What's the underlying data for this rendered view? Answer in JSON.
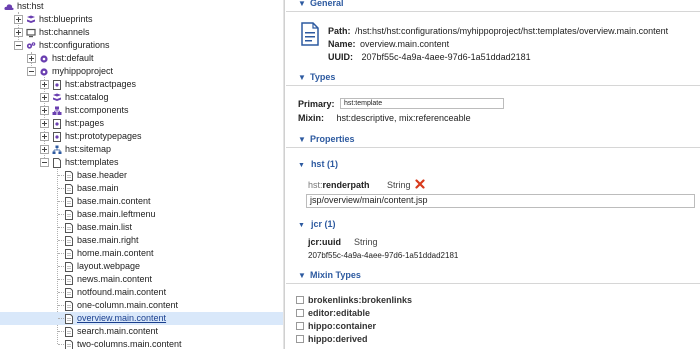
{
  "tree": {
    "root": "hst:hst",
    "blueprints": "hst:blueprints",
    "channels": "hst:channels",
    "configurations": "hst:configurations",
    "default": "hst:default",
    "project": "myhippoproject",
    "abstractpages": "hst:abstractpages",
    "catalog": "hst:catalog",
    "components": "hst:components",
    "pages": "hst:pages",
    "prototypepages": "hst:prototypepages",
    "sitemap": "hst:sitemap",
    "templates": "hst:templates",
    "template_items": [
      "base.header",
      "base.main",
      "base.main.content",
      "base.main.leftmenu",
      "base.main.list",
      "base.main.right",
      "home.main.content",
      "layout.webpage",
      "news.main.content",
      "notfound.main.content",
      "one-column.main.content",
      "overview.main.content",
      "search.main.content",
      "two-columns.main.content"
    ],
    "selected": "overview.main.content"
  },
  "general": {
    "title": "General",
    "path_label": "Path:",
    "path_value": "/hst:hst/hst:configurations/myhippoproject/hst:templates/overview.main.content",
    "name_label": "Name:",
    "name_value": "overview.main.content",
    "uuid_label": "UUID:",
    "uuid_value": "207bf55c-4a9a-4aee-97d6-1a51ddad2181"
  },
  "types": {
    "title": "Types",
    "primary_label": "Primary:",
    "primary_value": "hst:template",
    "mixin_label": "Mixin:",
    "mixin_value": "hst:descriptive, mix:referenceable"
  },
  "properties": {
    "title": "Properties",
    "hst_group": "hst (1)",
    "hst_prop_ns": "hst:",
    "hst_prop_name": "renderpath",
    "hst_prop_type": "String",
    "hst_prop_value": "jsp/overview/main/content.jsp",
    "jcr_group": "jcr (1)",
    "jcr_prop_ns": "jcr:",
    "jcr_prop_name": "uuid",
    "jcr_prop_type": "String",
    "jcr_prop_value": "207bf55c-4a9a-4aee-97d6-1a51ddad2181"
  },
  "mixin_types": {
    "title": "Mixin Types",
    "items": [
      "brokenlinks:brokenlinks",
      "editor:editable",
      "hippo:container",
      "hippo:derived"
    ]
  },
  "colors": {
    "accent": "#2d5aa0",
    "selection": "#d9e8fa",
    "cloud_icon": "#6a3fb0",
    "delete_icon": "#d83a1c"
  }
}
